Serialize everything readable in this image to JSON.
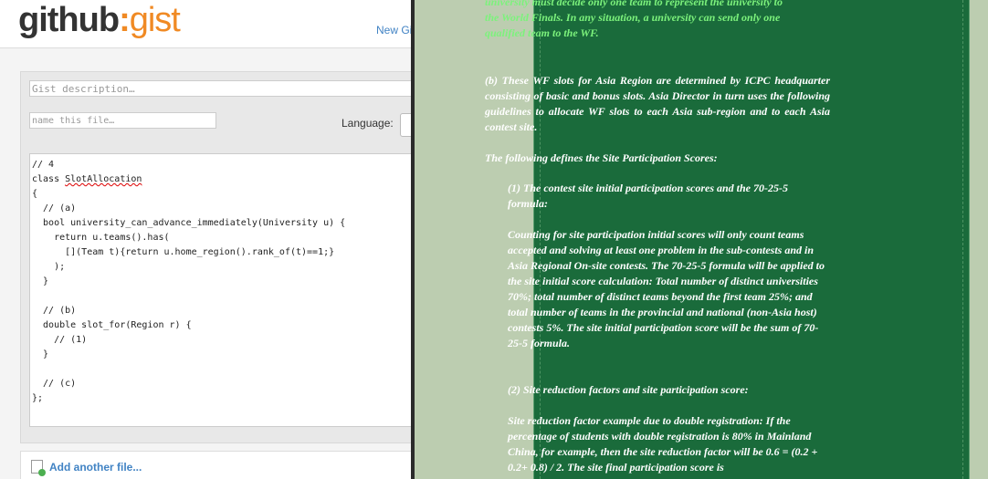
{
  "gist": {
    "logo": {
      "github": "github",
      "gist": "gist"
    },
    "new_gist_link": "New Gi",
    "description_placeholder": "Gist description…",
    "filename_placeholder": "name this file…",
    "language_label": "Language:",
    "code_lines": [
      "// 4",
      "class SlotAllocation",
      "{",
      "  // (a)",
      "  bool university_can_advance_immediately(University u) {",
      "    return u.teams().has(",
      "      [](Team t){return u.home_region().rank_of(t)==1;}",
      "    );",
      "  }",
      "",
      "  // (b)",
      "  double slot_for(Region r) {",
      "    // (1)",
      "  }",
      "",
      "  // (c)",
      "};"
    ],
    "add_file_label": "Add another file..."
  },
  "document": {
    "top_cut_line": "university must decide only one team to represent the university to",
    "para_a_lines": [
      "the World Finals. In any situation, a university can send only one",
      "qualified team to the WF."
    ],
    "para_b": "(b) These WF slots for Asia Region are determined by ICPC headquarter consisting of basic and bonus slots. Asia Director in turn uses the following guidelines to allocate WF slots to each Asia sub-region and to each Asia contest site.",
    "scores_heading": "The following defines the Site Participation Scores:",
    "item1_heading": "(1) The contest site initial participation scores and the 70-25-5 formula:",
    "item1_body": "Counting for site participation initial scores will only count teams accepted and solving at least one problem in the sub-contests and in Asia Regional On-site contests. The 70-25-5 formula will be applied to the site initial score calculation: Total number of distinct universities 70%; total number of distinct teams beyond the first team 25%; and total number of teams in the provincial and national (non-Asia host) contests 5%. The site initial participation score will be the sum of 70-25-5 formula.",
    "item2_heading": "(2) Site reduction factors and site participation score:",
    "item2_body": "Site reduction factor example due to double registration: If the percentage of students with double registration is 80% in Mainland China, for example, then the site reduction factor will be 0.6 = (0.2 + 0.2+ 0.8) / 2. The site final participation score is"
  }
}
